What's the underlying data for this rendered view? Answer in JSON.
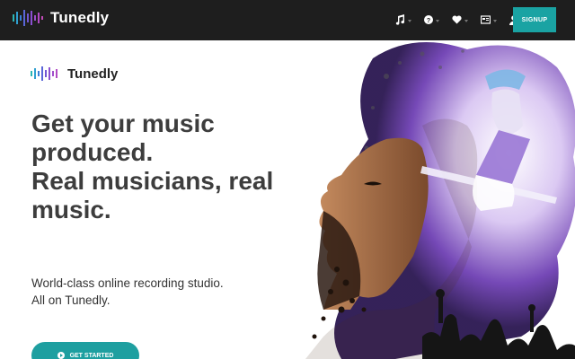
{
  "nav": {
    "brand": "Tunedly",
    "icons": [
      "music-note-icon",
      "help-icon",
      "heart-icon",
      "cart-icon",
      "user-icon"
    ],
    "signup_label": "SIGNUP"
  },
  "hero": {
    "brand": "Tunedly",
    "headline_lines": [
      "Get your music",
      "produced.",
      "Real musicians, real",
      "music."
    ],
    "sub_lines": [
      "World-class online recording studio.",
      "All on Tunedly."
    ],
    "cta_label": "GET STARTED"
  },
  "colors": {
    "nav_bg": "#1e1e1e",
    "accent": "#1aa3a3",
    "headline": "#3d3d3d"
  }
}
